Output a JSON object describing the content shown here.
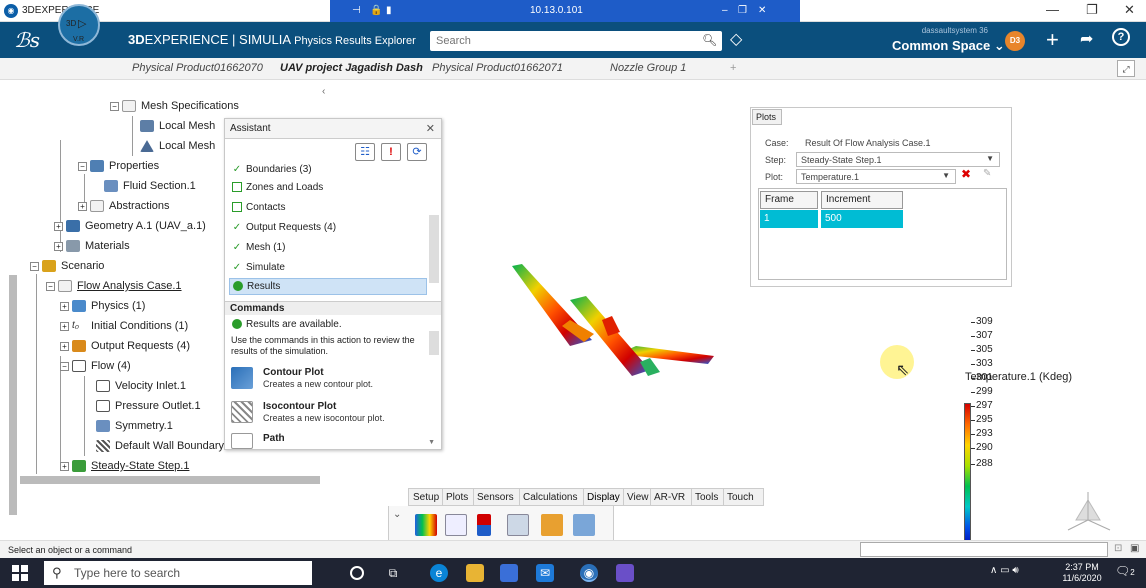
{
  "window": {
    "title": "3DEXPERIENCE",
    "remote_ip": "10.13.0.101"
  },
  "header": {
    "brand_bold": "3D",
    "brand_main": "EXPERIENCE | SIMULIA",
    "brand_app": " Physics Results Explorer",
    "search_placeholder": "Search",
    "user": "dassaultsystem 36",
    "space": "Common Space",
    "avatar": "D3",
    "compass_3d": "3D",
    "compass_vr": "V.R"
  },
  "tabs": [
    {
      "label": "Physical Product01662070"
    },
    {
      "label": "UAV project Jagadish Dash"
    },
    {
      "label": "Physical Product01662071"
    },
    {
      "label": "Nozzle Group 1"
    },
    {
      "label": "+"
    }
  ],
  "tree": {
    "mesh_specifications": "Mesh Specifications",
    "local_mesh_1": "Local Mesh",
    "local_mesh_2": "Local Mesh",
    "properties": "Properties",
    "fluid_section": "Fluid Section.1",
    "abstractions": "Abstractions",
    "geometry": "Geometry A.1 (UAV_a.1)",
    "materials": "Materials",
    "scenario": "Scenario",
    "flow_analysis": "Flow Analysis Case.1",
    "physics": "Physics (1)",
    "initial_conditions": "Initial Conditions (1)",
    "output_requests": "Output Requests (4)",
    "flow": "Flow (4)",
    "velocity_inlet": "Velocity Inlet.1",
    "pressure_outlet": "Pressure Outlet.1",
    "symmetry": "Symmetry.1",
    "default_wall": "Default Wall Boundary",
    "steady_state": "Steady-State Step.1"
  },
  "assistant": {
    "title": "Assistant",
    "steps": [
      {
        "label": "Boundaries (3)",
        "state": "done"
      },
      {
        "label": "Zones and Loads",
        "state": "todo"
      },
      {
        "label": "Contacts",
        "state": "todo"
      },
      {
        "label": "Output Requests (4)",
        "state": "done"
      },
      {
        "label": "Mesh (1)",
        "state": "done"
      },
      {
        "label": "Simulate",
        "state": "done"
      },
      {
        "label": "Results",
        "state": "active"
      }
    ],
    "commands_header": "Commands",
    "status": "Results are available.",
    "hint": "Use the commands in this action to review the results of the simulation.",
    "commands": [
      {
        "title": "Contour Plot",
        "desc": "Creates a new contour plot."
      },
      {
        "title": "Isocontour Plot",
        "desc": "Creates a new isocontour plot."
      },
      {
        "title": "Path",
        "desc": ""
      }
    ]
  },
  "plots": {
    "title": "Plots",
    "case_label": "Case:",
    "case_value": "Result Of Flow Analysis Case.1",
    "step_label": "Step:",
    "step_value": "Steady-State Step.1",
    "plot_label": "Plot:",
    "plot_value": "Temperature.1",
    "table": {
      "headers": [
        "Frame",
        "Increment"
      ],
      "rows": [
        [
          "1",
          "500"
        ]
      ]
    }
  },
  "legend": {
    "title": "Temperature.1 (Kdeg)",
    "ticks": [
      "309",
      "307",
      "305",
      "303",
      "301",
      "299",
      "297",
      "295",
      "293",
      "290",
      "288"
    ]
  },
  "action_tabs": [
    "Setup",
    "Plots",
    "Sensors",
    "Calculations",
    "Display",
    "View",
    "AR-VR",
    "Tools",
    "Touch"
  ],
  "status_bar": {
    "message": "Select an object or a command"
  },
  "taskbar": {
    "search_placeholder": "Type here to search",
    "time": "2:37 PM",
    "date": "11/6/2020",
    "notifications": "2"
  },
  "colors": {
    "header": "#0b4f7d",
    "accent": "#1e5cc8",
    "legend_top": "#d40000",
    "legend_bottom": "#0000b0",
    "selected_row": "#00bcd4"
  }
}
